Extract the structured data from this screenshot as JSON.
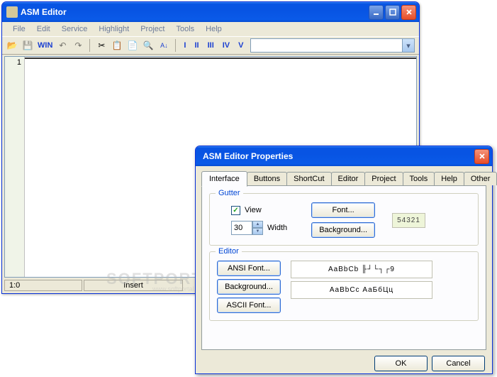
{
  "mainWindow": {
    "title": "ASM Editor",
    "menu": [
      "File",
      "Edit",
      "Service",
      "Highlight",
      "Project",
      "Tools",
      "Help"
    ],
    "winLabel": "WIN",
    "roman": [
      "I",
      "II",
      "III",
      "IV",
      "V"
    ],
    "lineNumber": "1",
    "status": {
      "position": "1:0",
      "mode": "Insert"
    }
  },
  "dialog": {
    "title": "ASM Editor Properties",
    "tabs": [
      "Interface",
      "Buttons",
      "ShortCut",
      "Editor",
      "Project",
      "Tools",
      "Help",
      "Other"
    ],
    "gutter": {
      "legend": "Gutter",
      "viewLabel": "View",
      "widthValue": "30",
      "widthLabel": "Width",
      "fontBtn": "Font...",
      "bgBtn": "Background...",
      "preview": "54321"
    },
    "editor": {
      "legend": "Editor",
      "ansiBtn": "ANSI Font...",
      "bgBtn": "Background...",
      "asciiBtn": "ASCII Font...",
      "preview1": "AaBbCb  ╟┘└┐┌9",
      "preview2": "AaBbCc АаБбЦц"
    },
    "okBtn": "OK",
    "cancelBtn": "Cancel"
  },
  "watermark": "SOFTPORTAL",
  "watermarkSub": "www.softportal.com"
}
